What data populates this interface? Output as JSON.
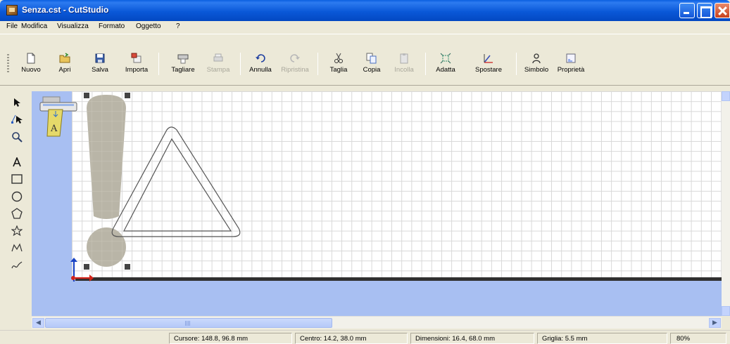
{
  "window": {
    "title": "Senza.cst - CutStudio"
  },
  "menu": [
    {
      "label": "File",
      "id": "file"
    },
    {
      "label": "Modifica",
      "id": "modifica"
    },
    {
      "label": "Visualizza",
      "id": "visualizza"
    },
    {
      "label": "Formato",
      "id": "formato"
    },
    {
      "label": "Oggetto",
      "id": "oggetto"
    },
    {
      "label": "?",
      "id": "help"
    }
  ],
  "toolbar": {
    "nuovo": "Nuovo",
    "apri": "Apri",
    "salva": "Salva",
    "importa": "Importa",
    "tagliare": "Tagliare",
    "stampa": "Stampa",
    "annulla": "Annulla",
    "ripristina": "Ripristina",
    "taglia": "Taglia",
    "copia": "Copia",
    "incolla": "Incolla",
    "adatta": "Adatta",
    "spostare": "Spostare",
    "simbolo": "Simbolo",
    "proprieta": "Proprietà"
  },
  "tools": [
    "select-arrow-icon",
    "node-edit-icon",
    "zoom-icon",
    "text-icon",
    "rectangle-icon",
    "ellipse-icon",
    "polygon-icon",
    "star-icon",
    "polyline-icon",
    "curve-icon"
  ],
  "status": {
    "cursore": "Cursore: 148.8, 96.8 mm",
    "centro": "Centro: 14.2, 38.0 mm",
    "dimensioni": "Dimensioni: 16.4, 68.0 mm",
    "griglia": "Griglia: 5.5 mm",
    "zoom": "80%"
  },
  "colors": {
    "titlebar": "#0a58d8",
    "canvas_bg": "#a8bff2",
    "shape_fill": "#b9b5a7",
    "grid": "#d8d8d8"
  }
}
